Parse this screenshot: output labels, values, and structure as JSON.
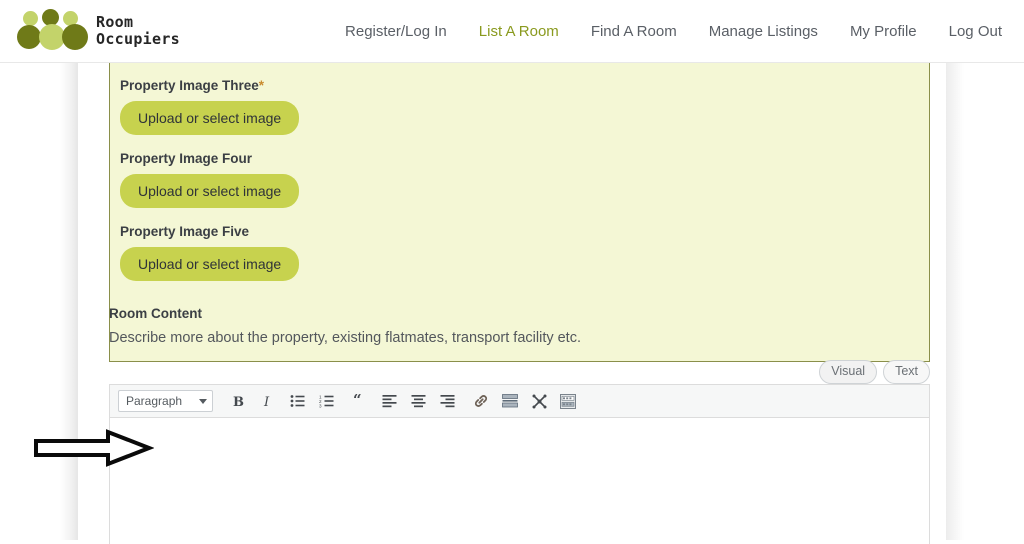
{
  "header": {
    "brand_line1": "Room",
    "brand_line2": "Occupiers",
    "logo_name": "room-occupiers-logo",
    "nav": [
      {
        "label": "Register/Log In",
        "active": false
      },
      {
        "label": "List A Room",
        "active": true
      },
      {
        "label": "Find A Room",
        "active": false
      },
      {
        "label": "Manage Listings",
        "active": false
      },
      {
        "label": "My Profile",
        "active": false
      },
      {
        "label": "Log Out",
        "active": false
      }
    ]
  },
  "image_panel": {
    "fields": [
      {
        "label": "Property Image Three",
        "required": true,
        "required_mark": "*",
        "button": "Upload or select image"
      },
      {
        "label": "Property Image Four",
        "required": false,
        "required_mark": "",
        "button": "Upload or select image"
      },
      {
        "label": "Property Image Five",
        "required": false,
        "required_mark": "",
        "button": "Upload or select image"
      }
    ]
  },
  "room_content": {
    "label": "Room Content",
    "description": "Describe more about the property, existing flatmates, transport facility etc."
  },
  "editor": {
    "tabs": [
      {
        "label": "Visual",
        "active": true
      },
      {
        "label": "Text",
        "active": false
      }
    ],
    "format_select": {
      "value": "Paragraph",
      "caret_icon": "chevron-down-icon"
    },
    "toolbar": [
      {
        "name": "bold-icon",
        "title": "Bold"
      },
      {
        "name": "italic-icon",
        "title": "Italic"
      },
      {
        "name": "bulleted-list-icon",
        "title": "Bulleted list"
      },
      {
        "name": "numbered-list-icon",
        "title": "Numbered list"
      },
      {
        "name": "blockquote-icon",
        "title": "Blockquote"
      },
      {
        "name": "align-left-icon",
        "title": "Align left"
      },
      {
        "name": "align-center-icon",
        "title": "Align center"
      },
      {
        "name": "align-right-icon",
        "title": "Align right"
      },
      {
        "name": "insert-link-icon",
        "title": "Insert/edit link"
      },
      {
        "name": "read-more-icon",
        "title": "Insert Read More tag"
      },
      {
        "name": "fullscreen-icon",
        "title": "Distraction-free writing mode"
      },
      {
        "name": "toolbar-toggle-icon",
        "title": "Toolbar Toggle"
      }
    ],
    "body_text": ""
  },
  "annotation": {
    "arrow_name": "pointer-arrow-annotation"
  },
  "colors": {
    "accent_green": "#8a9a1f",
    "button_green": "#c7d24e",
    "panel_bg": "#f4f7d5",
    "panel_border": "#8a8f4a",
    "required_mark": "#c98b2e",
    "logo_dark": "#6f7a18",
    "logo_light": "#c3d36a"
  }
}
